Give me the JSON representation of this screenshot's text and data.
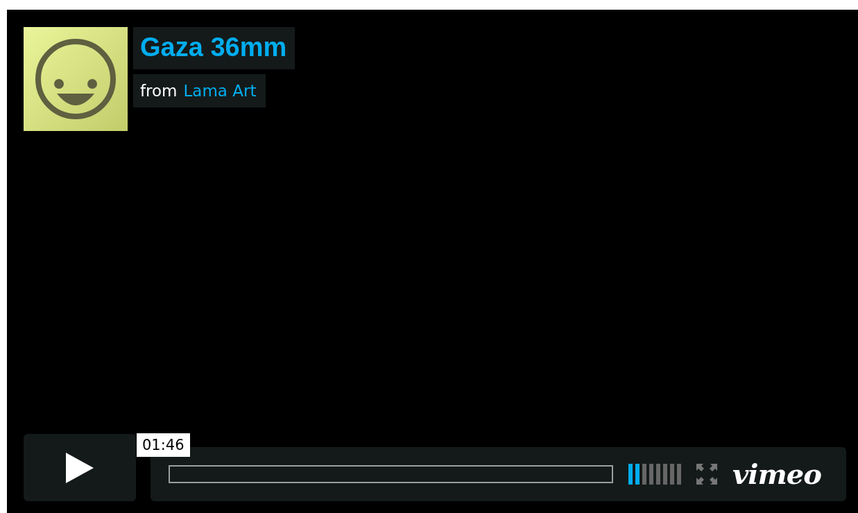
{
  "title": "Gaza 36mm",
  "byline": {
    "prefix": "from",
    "author": "Lama Art"
  },
  "controls": {
    "playing": false,
    "time_tooltip": "01:46",
    "volume": {
      "level": 0.25
    },
    "logo": "vimeo"
  }
}
